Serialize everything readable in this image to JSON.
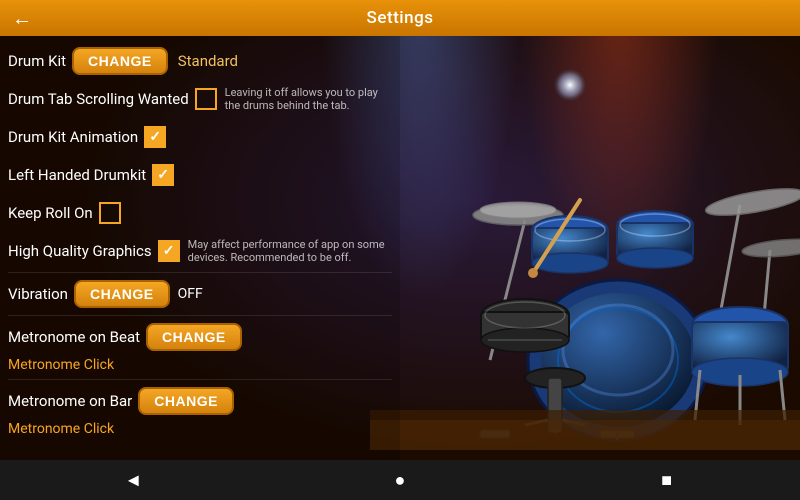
{
  "header": {
    "title": "Settings",
    "back_icon": "←"
  },
  "settings": {
    "drum_kit": {
      "label": "Drum Kit",
      "change_btn": "CHANGE",
      "current_value": "Standard"
    },
    "drum_tab_scrolling": {
      "label": "Drum Tab Scrolling Wanted",
      "checked": false,
      "hint": "Leaving it off allows you to play the drums behind the tab."
    },
    "drum_kit_animation": {
      "label": "Drum Kit Animation",
      "checked": true
    },
    "left_handed_drumkit": {
      "label": "Left Handed Drumkit",
      "checked": true
    },
    "keep_roll_on": {
      "label": "Keep Roll On",
      "checked": false
    },
    "high_quality_graphics": {
      "label": "High Quality Graphics",
      "checked": true,
      "hint": "May affect performance of app on some devices. Recommended to be off."
    },
    "vibration": {
      "label": "Vibration",
      "change_btn": "CHANGE",
      "current_value": "OFF"
    },
    "metronome_on_beat": {
      "label": "Metronome on Beat",
      "change_btn": "CHANGE",
      "click_label": "Metronome Click"
    },
    "metronome_on_bar": {
      "label": "Metronome on Bar",
      "change_btn": "CHANGE",
      "click_label": "Metronome Click"
    }
  },
  "nav": {
    "back": "◄",
    "home": "●",
    "recent": "■"
  }
}
